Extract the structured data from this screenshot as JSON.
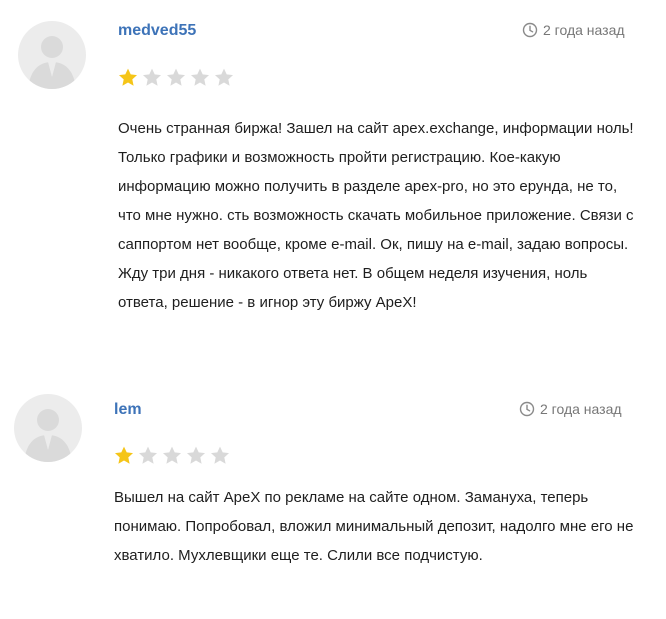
{
  "reviews": [
    {
      "author": "medved55",
      "date": "2 года назад",
      "rating": 1,
      "max_rating": 5,
      "text": "Очень странная биржа! Зашел на сайт apex.exchange, информации ноль! Только графики и возможность пройти регистрацию. Кое-какую информацию можно получить в разделе apex-pro, но это ерунда, не то, что мне нужно. сть возможность скачать мобильное приложение. Связи с саппортом нет вообще, кроме e-mail. Ок, пишу на e-mail, задаю вопросы. Жду три дня - никакого ответа нет. В общем неделя изучения, ноль ответа, решение - в игнор эту биржу ApeX!"
    },
    {
      "author": "lem",
      "date": "2 года назад",
      "rating": 1,
      "max_rating": 5,
      "text": "Вышел на сайт ApeX по рекламе на сайте одном. Замануха, теперь понимаю. Попробовал, вложил минимальный депозит, надолго мне его не хватило. Мухлевщики еще те. Слили все подчистую."
    }
  ],
  "colors": {
    "author_link": "#3d73b8",
    "star_filled": "#f5c518",
    "star_empty": "#d9d9d9",
    "muted_text": "#777777",
    "avatar_bg": "#ececec"
  },
  "icons": {
    "avatar": "user-silhouette-icon",
    "date": "clock-icon",
    "rating": "star-icon"
  }
}
